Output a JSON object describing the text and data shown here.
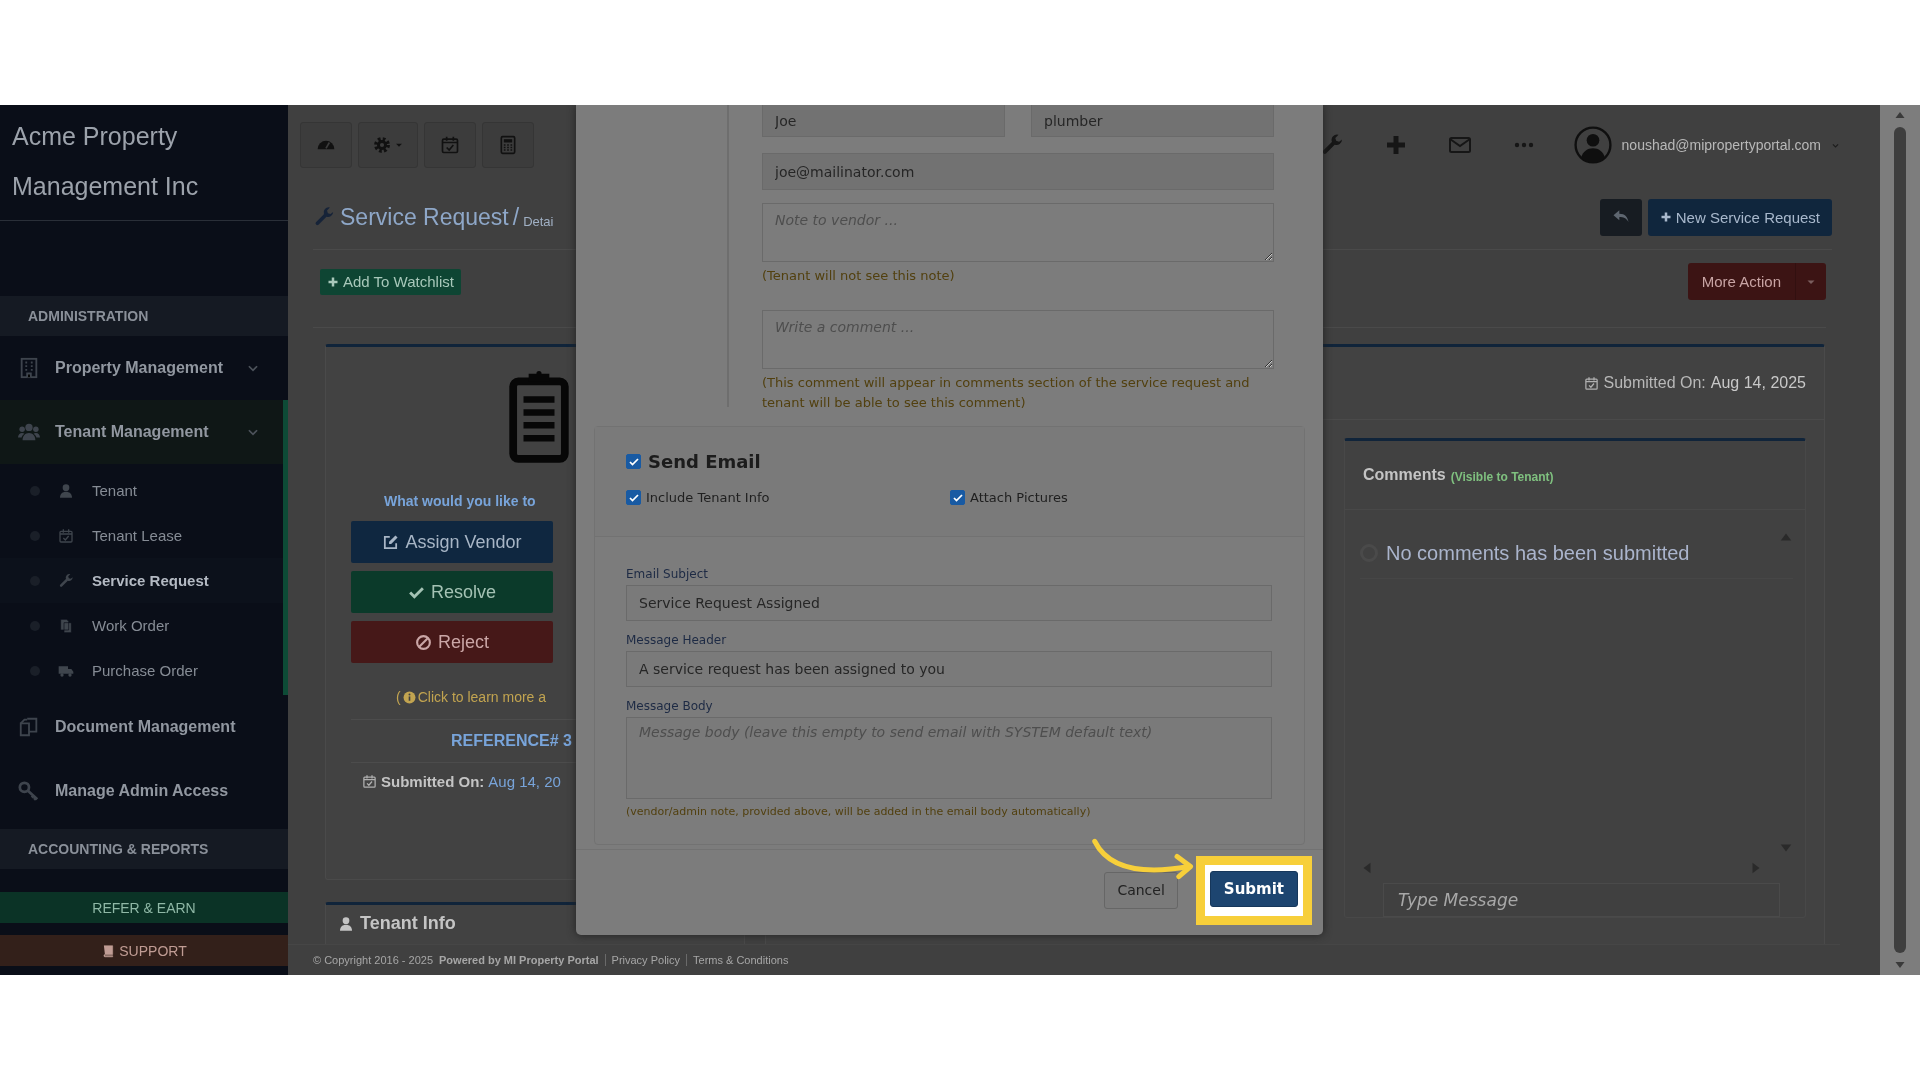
{
  "sidebar": {
    "brand": "Acme Property Management Inc",
    "sections": [
      {
        "heading": "ADMINISTRATION",
        "items": [
          {
            "label": "Property Management",
            "kind": "menu",
            "selected": false
          },
          {
            "label": "Tenant Management",
            "kind": "menu",
            "selected": true,
            "expanded": true,
            "children": [
              {
                "label": "Tenant",
                "selected": false
              },
              {
                "label": "Tenant Lease",
                "selected": false
              },
              {
                "label": "Service Request",
                "selected": true
              },
              {
                "label": "Work Order",
                "selected": false
              },
              {
                "label": "Purchase Order",
                "selected": false
              }
            ]
          },
          {
            "label": "Document Management",
            "kind": "link",
            "selected": false
          },
          {
            "label": "Manage Admin Access",
            "kind": "link",
            "selected": false
          }
        ]
      },
      {
        "heading": "ACCOUNTING & REPORTS"
      }
    ],
    "buttons": [
      {
        "label": "REFER & EARN",
        "kind": "success"
      },
      {
        "label": "SUPPORT",
        "kind": "danger"
      }
    ]
  },
  "topbar": {
    "user_email": "noushad@mipropertyportal.com"
  },
  "header": {
    "title": "Service Request",
    "separator": "/",
    "crumb": "Detai",
    "button": "New Service Request"
  },
  "watchlist_button": "Add To Watchlist",
  "more_action": "More Action",
  "action_panel": {
    "prompt": "What would you like to",
    "buttons": [
      {
        "label": "Assign Vendor",
        "kind": "primary"
      },
      {
        "label": "Resolve",
        "kind": "success"
      },
      {
        "label": "Reject",
        "kind": "danger"
      }
    ],
    "learn_more_open": "(",
    "learn_more": "Click to learn more a",
    "reference": "REFERENCE# 3",
    "submitted_label": "Submitted On:",
    "submitted_date": "Aug 14, 20"
  },
  "tenant_info": {
    "title": "Tenant Info"
  },
  "details": {
    "submitted_label": "Submitted On:",
    "submitted_date": "Aug 14, 2025"
  },
  "comments": {
    "title": "Comments",
    "note": "(Visible to Tenant)",
    "empty_text": "No comments has been submitted",
    "message_placeholder": "Type Message"
  },
  "footer": {
    "copyright": "© Copyright 2016 - 2025",
    "powered": "Powered by MI Property Portal",
    "links": [
      "Privacy Policy",
      "Terms & Conditions"
    ]
  },
  "modal": {
    "row_fields": [
      {
        "value": "Joe"
      },
      {
        "value": "plumber"
      }
    ],
    "email": {
      "value": "joe@mailinator.com"
    },
    "note": {
      "placeholder": "Note to vendor ...",
      "hint": "(Tenant will not see this note)"
    },
    "comment": {
      "placeholder": "Write a comment ...",
      "hint": "(This comment will appear in comments section of the service request and tenant will be able to see this comment)"
    },
    "send_email": {
      "label": "Send Email",
      "checked": true,
      "options": [
        {
          "label": "Include Tenant Info",
          "checked": true
        },
        {
          "label": "Attach Pictures",
          "checked": true
        }
      ],
      "fields": [
        {
          "label": "Email Subject",
          "kind": "input",
          "value": "Service Request Assigned"
        },
        {
          "label": "Message Header",
          "kind": "input",
          "value": "A service request has been assigned to you"
        },
        {
          "label": "Message Body",
          "kind": "textarea",
          "placeholder": "Message body (leave this empty to send email with SYSTEM default text)"
        }
      ],
      "hint": "(vendor/admin note, provided above, will be added in the email body automatically)"
    },
    "buttons": [
      {
        "label": "Cancel",
        "kind": "default",
        "highlighted": false
      },
      {
        "label": "Submit",
        "kind": "primary",
        "highlighted": true
      }
    ]
  }
}
